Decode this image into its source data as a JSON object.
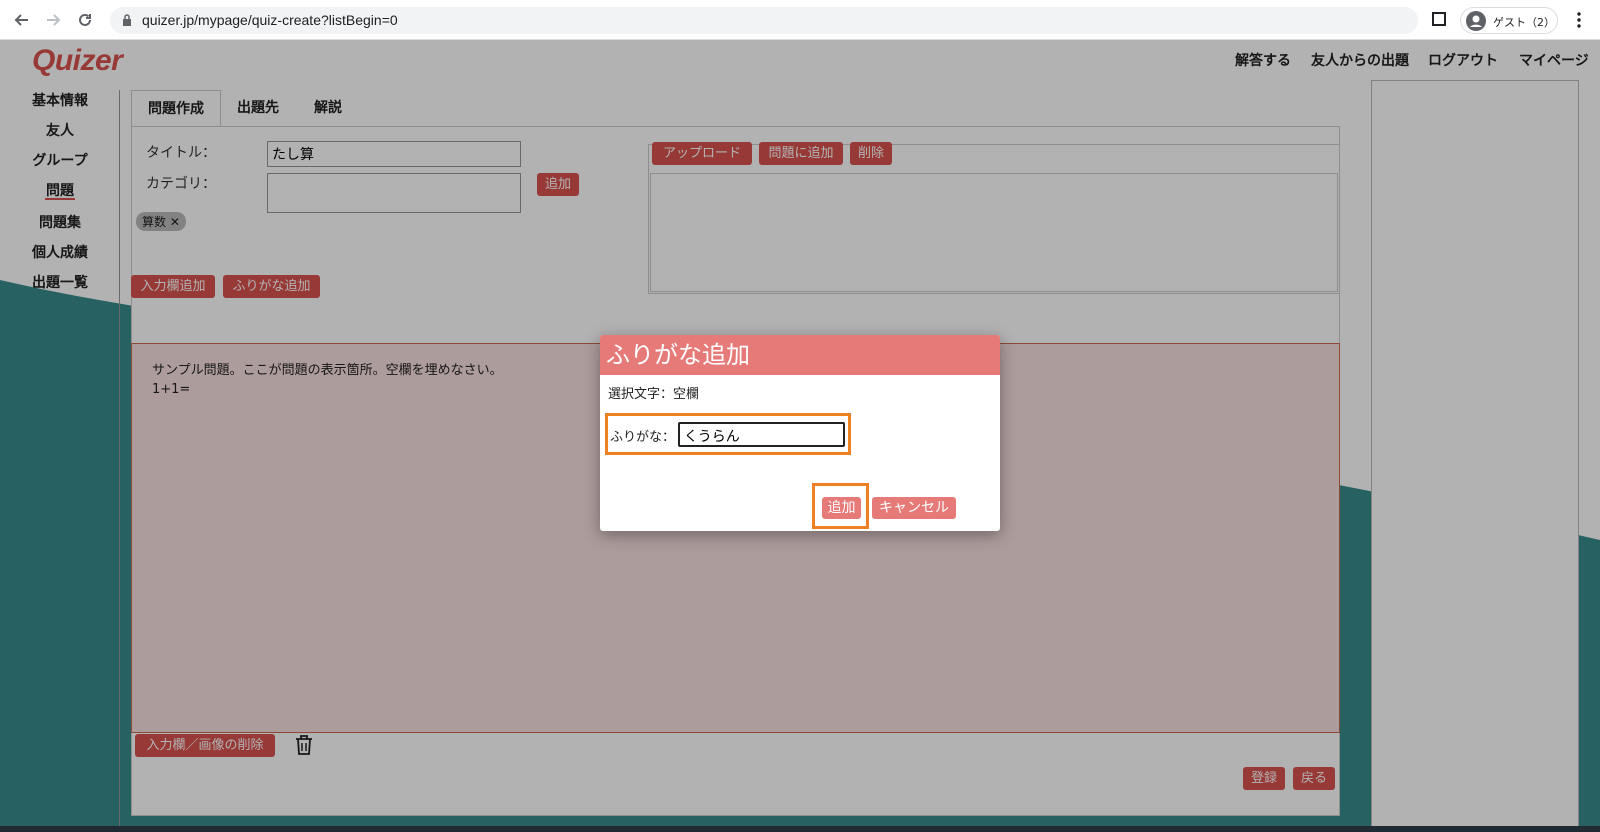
{
  "browser": {
    "url": "quizer.jp/mypage/quiz-create?listBegin=0",
    "profile_label": "ゲスト（2）"
  },
  "site": {
    "logo": "Quizer",
    "topnav": [
      "解答する",
      "友人からの出題",
      "ログアウト",
      "マイページ"
    ]
  },
  "sidebar": {
    "items": [
      "基本情報",
      "友人",
      "グループ",
      "問題",
      "問題集",
      "個人成績",
      "出題一覧"
    ],
    "active": "問題"
  },
  "tabs": [
    "問題作成",
    "出題先",
    "解説"
  ],
  "form": {
    "title_label": "タイトル：",
    "title_value": "たし算",
    "category_label": "カテゴリ：",
    "category_add": "追加",
    "tags": [
      "算数"
    ],
    "add_field": "入力欄追加",
    "add_furigana": "ふりがな追加",
    "upload_buttons": [
      "アップロード",
      "問題に追加",
      "削除"
    ],
    "question_lines": [
      "サンプル問題。ここが問題の表示箇所。空欄を埋めなさい。",
      "1+1="
    ],
    "delete_fields": "入力欄／画像の削除",
    "register": "登録",
    "back": "戻る"
  },
  "dialog": {
    "title": "ふりがな追加",
    "selected_text": "選択文字：空欄",
    "furigana_label": "ふりがな：",
    "furigana_value": "くうらん",
    "add": "追加",
    "cancel": "キャンセル"
  },
  "colors": {
    "accent": "#d9534f",
    "dialog_header": "#e57a78",
    "highlight": "#f08024",
    "wave": "#3a8c8c"
  }
}
